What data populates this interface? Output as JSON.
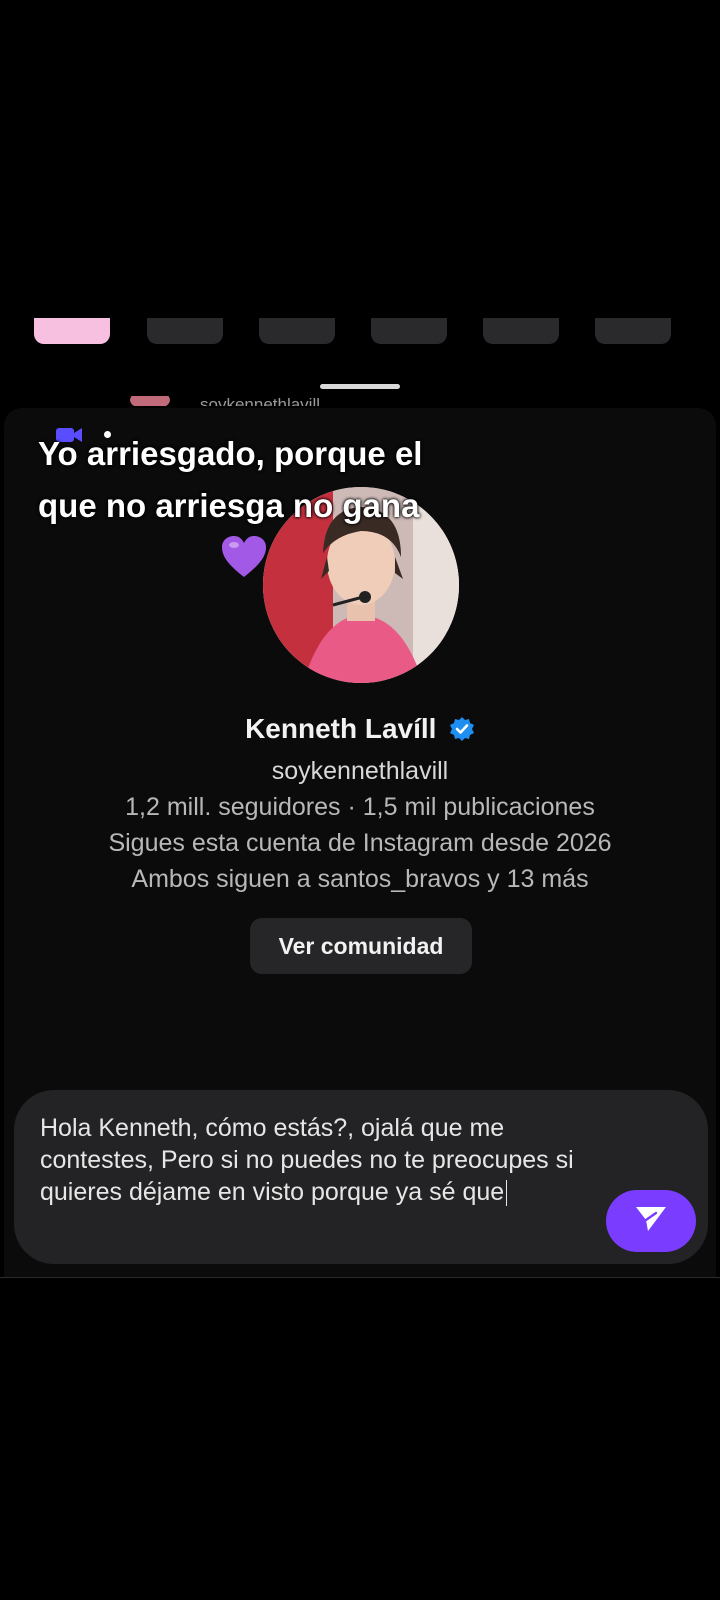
{
  "caption": {
    "line1": "Yo arriesgado, porque el",
    "line2": "que no arriesga no gana"
  },
  "peek": {
    "username": "soykennethlavill"
  },
  "profile": {
    "name": "Kenneth Lavíll",
    "username": "soykennethlavill",
    "stats": "1,2 mill. seguidores · 1,5 mil publicaciones",
    "follow_since": "Sigues esta cuenta de Instagram desde 2026",
    "mutual": "Ambos siguen a santos_bravos y 13 más",
    "community_button": "Ver comunidad"
  },
  "composer": {
    "message": "Hola Kenneth, cómo estás?, ojalá que me contestes, Pero si no puedes no te preocupes si quieres déjame en visto porque ya sé que"
  },
  "colors": {
    "accent": "#7a3cff",
    "verified": "#1f8ef1",
    "active_tab": "#f7bfe0",
    "heart": "#a259e6"
  },
  "icons": {
    "verified": "verified-badge-icon",
    "send": "send-icon",
    "heart": "purple-heart-icon",
    "camera": "video-camera-icon"
  }
}
